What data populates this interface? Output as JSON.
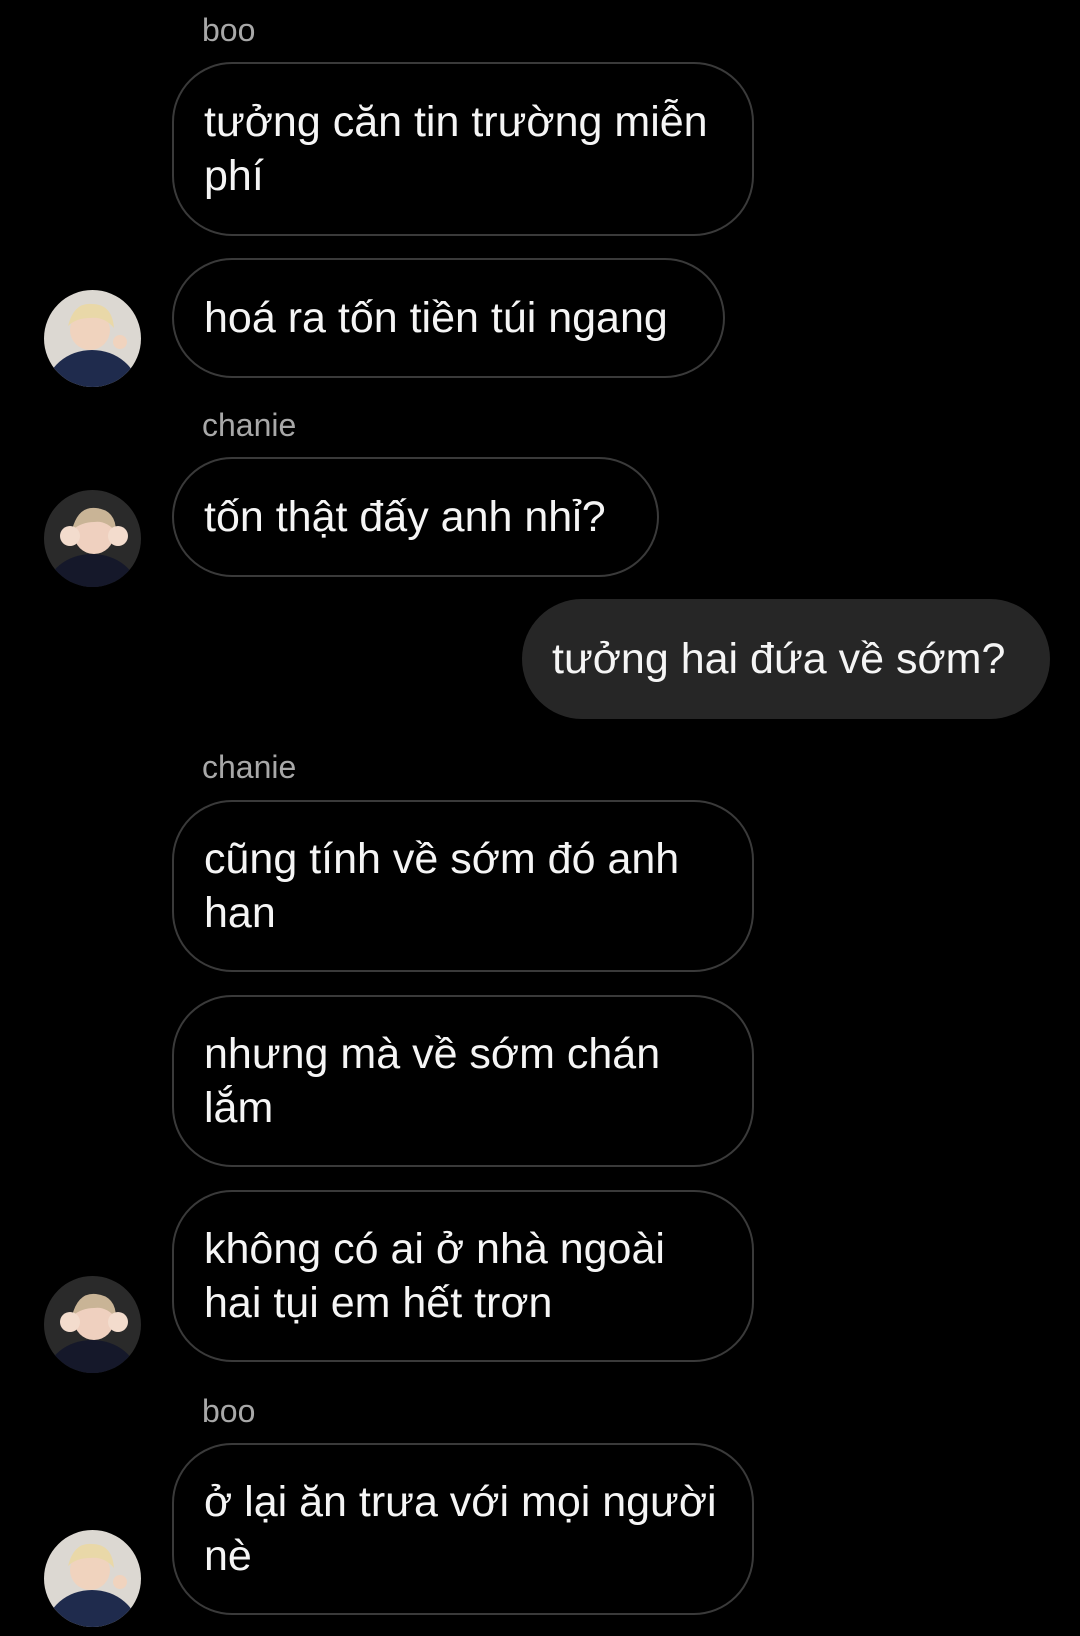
{
  "colors": {
    "background": "#000000",
    "incoming_border": "#3a3a3a",
    "outgoing_fill": "#262626",
    "sender_label": "#a8a8a8",
    "text": "#f5f5f5"
  },
  "messages": [
    {
      "sender": "boo",
      "text": "tưởng căn tin trường miễn\nphí"
    },
    {
      "text": "hoá ra tốn tiền túi ngang",
      "avatar": "boo-avatar"
    },
    {
      "sender": "chanie",
      "text": "tốn thật đấy anh nhỉ?",
      "avatar": "chanie-avatar"
    },
    {
      "text": "tưởng hai đứa về sớm?",
      "direction": "outgoing"
    },
    {
      "sender": "chanie",
      "text": "cũng tính về sớm đó anh\nhan"
    },
    {
      "text": "nhưng mà về sớm chán\nlắm"
    },
    {
      "text": "không có ai ở nhà ngoài\nhai tụi em hết trơn",
      "avatar": "chanie-avatar"
    },
    {
      "sender": "boo",
      "text": "ở lại ăn trưa với mọi người\nnè",
      "avatar": "boo-avatar"
    }
  ]
}
